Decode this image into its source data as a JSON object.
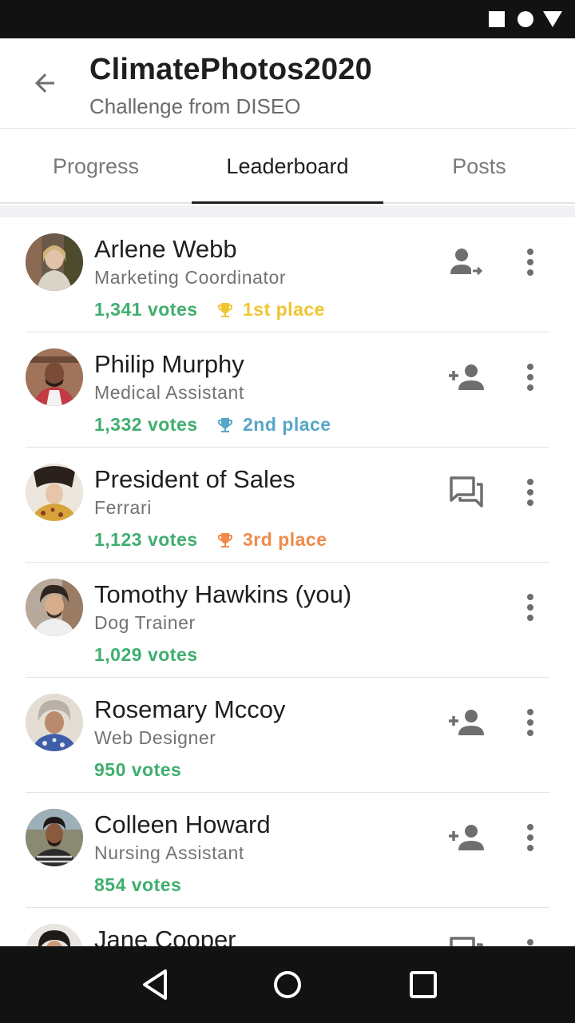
{
  "header": {
    "title": "ClimatePhotos2020",
    "subtitle": "Challenge from DISEO"
  },
  "tabs": [
    {
      "label": "Progress",
      "active": false
    },
    {
      "label": "Leaderboard",
      "active": true
    },
    {
      "label": "Posts",
      "active": false
    }
  ],
  "colors": {
    "votes": "#3fae6e",
    "first_place": "#f0c530",
    "second_place": "#56a7c7",
    "third_place": "#f08a4b",
    "icon_gray": "#6e6e6e"
  },
  "leaderboard": [
    {
      "name": "Arlene Webb",
      "role": "Marketing Coordinator",
      "votes": "1,341 votes",
      "place": "1st place",
      "action_icon": "person-transfer-icon"
    },
    {
      "name": "Philip Murphy",
      "role": "Medical Assistant",
      "votes": "1,332 votes",
      "place": "2nd place",
      "action_icon": "person-add-icon"
    },
    {
      "name": "President of Sales",
      "role": "Ferrari",
      "votes": "1,123 votes",
      "place": "3rd place",
      "action_icon": "chat-icon"
    },
    {
      "name": "Tomothy Hawkins (you)",
      "role": "Dog Trainer",
      "votes": "1,029 votes",
      "place": "",
      "action_icon": ""
    },
    {
      "name": "Rosemary Mccoy",
      "role": "Web Designer",
      "votes": "950 votes",
      "place": "",
      "action_icon": "person-add-icon"
    },
    {
      "name": "Colleen Howard",
      "role": "Nursing Assistant",
      "votes": "854 votes",
      "place": "",
      "action_icon": "person-add-icon"
    },
    {
      "name": "Jane Cooper",
      "role": "",
      "votes": "",
      "place": "",
      "action_icon": "chat-icon"
    }
  ]
}
